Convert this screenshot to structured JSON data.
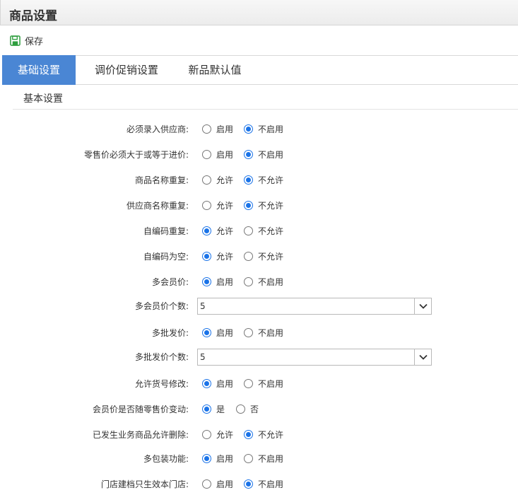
{
  "page": {
    "title": "商品设置"
  },
  "toolbar": {
    "save_label": "保存"
  },
  "tabs": [
    {
      "label": "基础设置",
      "active": true
    },
    {
      "label": "调价促销设置",
      "active": false
    },
    {
      "label": "新品默认值",
      "active": false
    }
  ],
  "section": {
    "title": "基本设置"
  },
  "settings": [
    {
      "label": "必须录入供应商:",
      "options": [
        "启用",
        "不启用"
      ],
      "selected": 1
    },
    {
      "label": "零售价必须大于或等于进价:",
      "options": [
        "启用",
        "不启用"
      ],
      "selected": 1
    },
    {
      "label": "商品名称重复:",
      "options": [
        "允许",
        "不允许"
      ],
      "selected": 1
    },
    {
      "label": "供应商名称重复:",
      "options": [
        "允许",
        "不允许"
      ],
      "selected": 1
    },
    {
      "label": "自编码重复:",
      "options": [
        "允许",
        "不允许"
      ],
      "selected": 0
    },
    {
      "label": "自编码为空:",
      "options": [
        "允许",
        "不允许"
      ],
      "selected": 0
    },
    {
      "label": "多会员价:",
      "options": [
        "启用",
        "不启用"
      ],
      "selected": 0
    },
    {
      "label": "多会员价个数:",
      "select_value": "5"
    },
    {
      "label": "多批发价:",
      "options": [
        "启用",
        "不启用"
      ],
      "selected": 0
    },
    {
      "label": "多批发价个数:",
      "select_value": "5"
    },
    {
      "label": "允许货号修改:",
      "options": [
        "启用",
        "不启用"
      ],
      "selected": 0
    },
    {
      "label": "会员价是否随零售价变动:",
      "options": [
        "是",
        "否"
      ],
      "selected": 0
    },
    {
      "label": "已发生业务商品允许删除:",
      "options": [
        "允许",
        "不允许"
      ],
      "selected": 1
    },
    {
      "label": "多包装功能:",
      "options": [
        "启用",
        "不启用"
      ],
      "selected": 0
    },
    {
      "label": "门店建档只生效本门店:",
      "options": [
        "启用",
        "不启用"
      ],
      "selected": 1
    }
  ],
  "colors": {
    "accent": "#4a86d4",
    "radio": "#1a73e8",
    "save_icon": "#2e9e3e"
  },
  "icons": {
    "save": "save-icon",
    "dropdown": "chevron-down-icon"
  }
}
